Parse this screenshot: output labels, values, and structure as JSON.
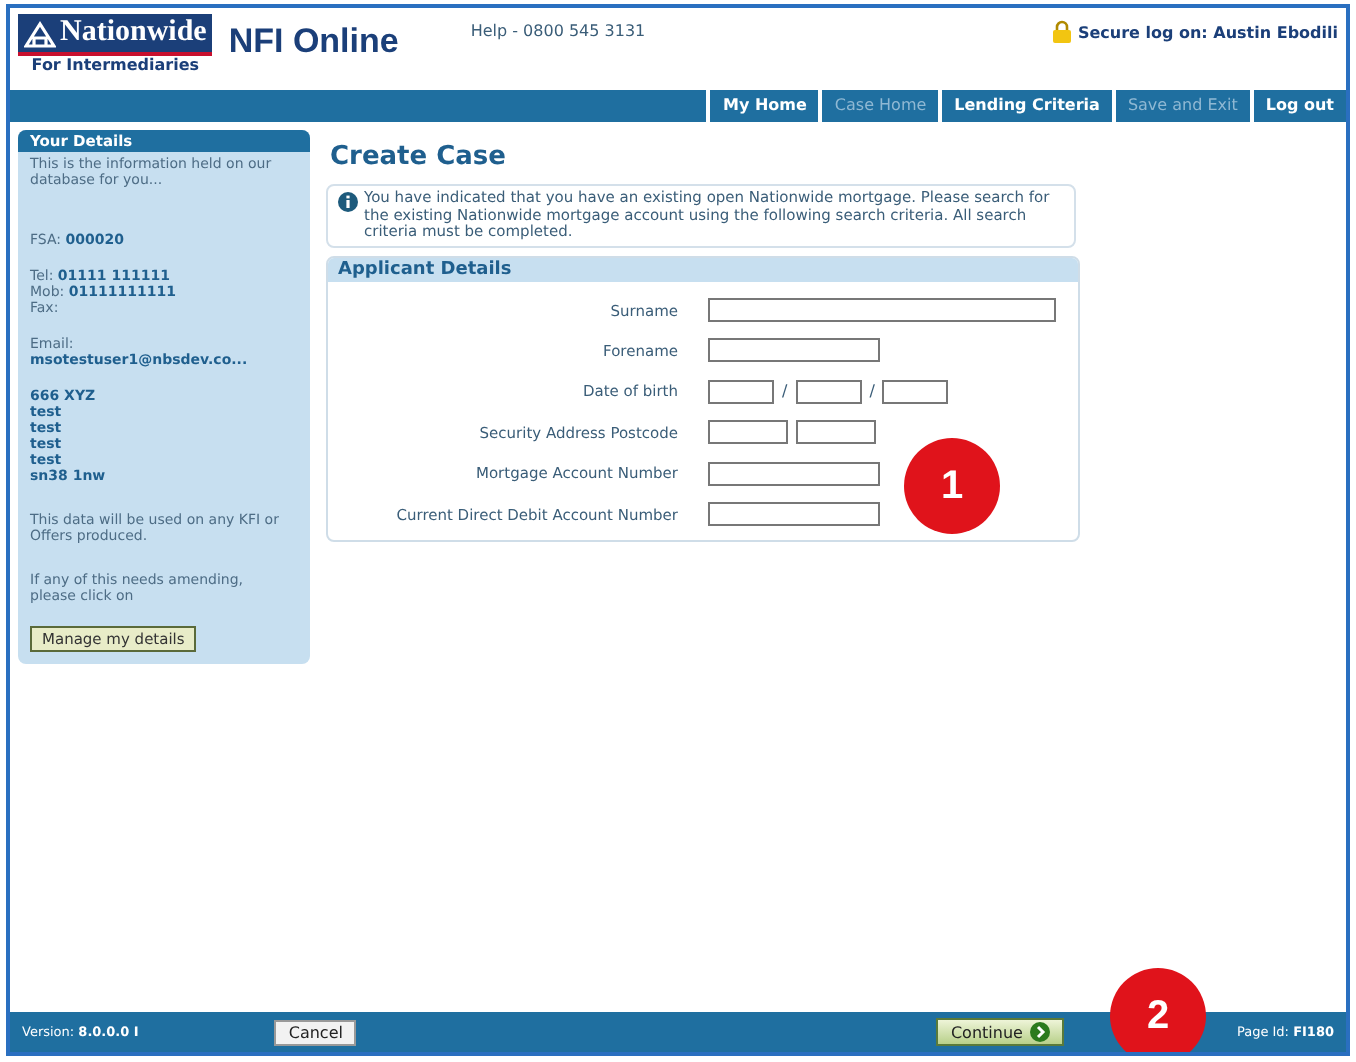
{
  "header": {
    "brand": "Nationwide",
    "brand_sub": "For Intermediaries",
    "product": "NFI Online",
    "help": "Help - 0800 545 3131",
    "secure": "Secure log on: Austin Ebodili"
  },
  "nav": [
    {
      "label": "My Home",
      "disabled": false
    },
    {
      "label": "Case Home",
      "disabled": true
    },
    {
      "label": "Lending Criteria",
      "disabled": false
    },
    {
      "label": "Save and Exit",
      "disabled": true
    },
    {
      "label": "Log out",
      "disabled": false
    }
  ],
  "sidebar": {
    "title": "Your Details",
    "intro": "This is the information held on our database for you...",
    "groups": [
      [
        {
          "label": "FSA: ",
          "value": "000020"
        }
      ],
      [
        {
          "label": "Tel: ",
          "value": "01111 111111"
        },
        {
          "label": "Mob: ",
          "value": "01111111111"
        },
        {
          "label": "Fax:"
        }
      ],
      [
        {
          "label": "Email:"
        },
        {
          "value": "msotestuser1@nbsdev.co..."
        }
      ],
      [
        {
          "value": "666 XYZ"
        },
        {
          "value": "test"
        },
        {
          "value": "test"
        },
        {
          "value": "test"
        },
        {
          "value": "test"
        },
        {
          "value": "sn38 1nw"
        }
      ]
    ],
    "note": "This data will be used on any KFI or Offers produced.",
    "amend": "If any of this needs amending, please click on",
    "button": "Manage my details"
  },
  "page_title": "Create Case",
  "info": "You have indicated that you have an existing open Nationwide mortgage. Please search for the existing Nationwide mortgage account using the following search criteria. All search criteria must be completed.",
  "panel": {
    "title": "Applicant Details",
    "fields": [
      {
        "label": "Surname",
        "kind": "wide"
      },
      {
        "label": "Forename",
        "kind": "medium"
      },
      {
        "label": "Date of birth",
        "kind": "date",
        "separator": "/"
      },
      {
        "label": "Security Address Postcode",
        "kind": "postcode"
      },
      {
        "label": "Mortgage Account Number",
        "kind": "medium"
      },
      {
        "label": "Current Direct Debit Account Number",
        "kind": "medium"
      }
    ]
  },
  "callouts": [
    "1",
    "2"
  ],
  "footer": {
    "version_label": "Version: ",
    "version": "8.0.0.0 I",
    "cancel": "Cancel",
    "continue": "Continue",
    "page_id_label": "Page Id: ",
    "page_id": "FI180"
  }
}
